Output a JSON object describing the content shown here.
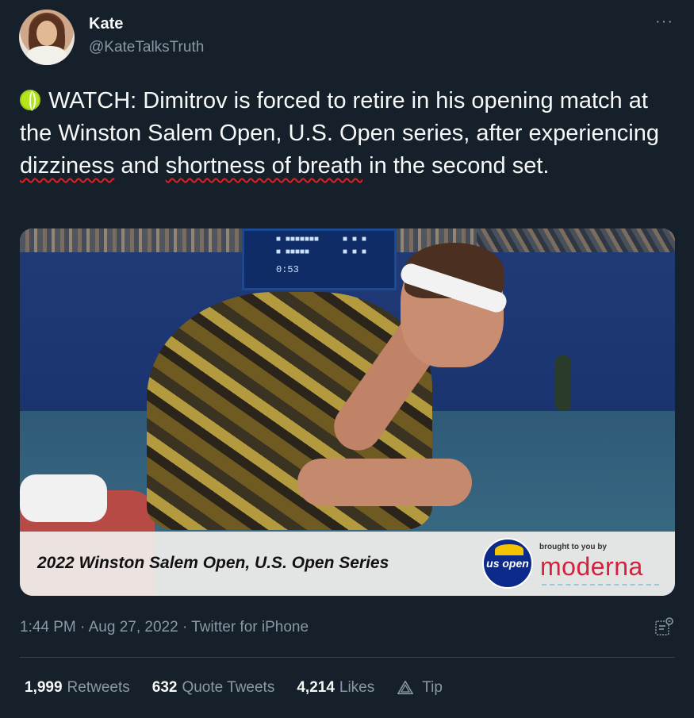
{
  "user": {
    "name": "Kate",
    "handle": "@KateTalksTruth"
  },
  "more_label": "···",
  "tweet": {
    "part1": "WATCH: Dimitrov is forced to retire in his opening match at the Winston Salem Open, U.S. Open series, after experiencing",
    "underline1": "dizziness",
    "part2": "and",
    "underline2": "shortness of breath",
    "part3": "in the second set."
  },
  "media": {
    "caption": "2022 Winston Salem Open, U.S. Open Series",
    "usopen_logo_text": "us open",
    "sponsor_prefix": "brought to you by",
    "sponsor_name": "moderna",
    "scoreboard_time": "0:53"
  },
  "meta": {
    "time": "1:44 PM",
    "separator": "·",
    "date": "Aug 27, 2022",
    "source": "Twitter for iPhone"
  },
  "stats": {
    "retweets_count": "1,999",
    "retweets_label": "Retweets",
    "quotes_count": "632",
    "quotes_label": "Quote Tweets",
    "likes_count": "4,214",
    "likes_label": "Likes",
    "tip_label": "Tip"
  },
  "icons": {
    "emoji": "tennis-ball-icon",
    "analytics": "analytics-icon",
    "tip": "tip-icon"
  },
  "colors": {
    "background": "#15202b",
    "primary_text": "#f7f9f9",
    "secondary_text": "#8b98a5",
    "divider": "#38444d",
    "underline": "#e02020",
    "moderna_red": "#d4213d"
  }
}
